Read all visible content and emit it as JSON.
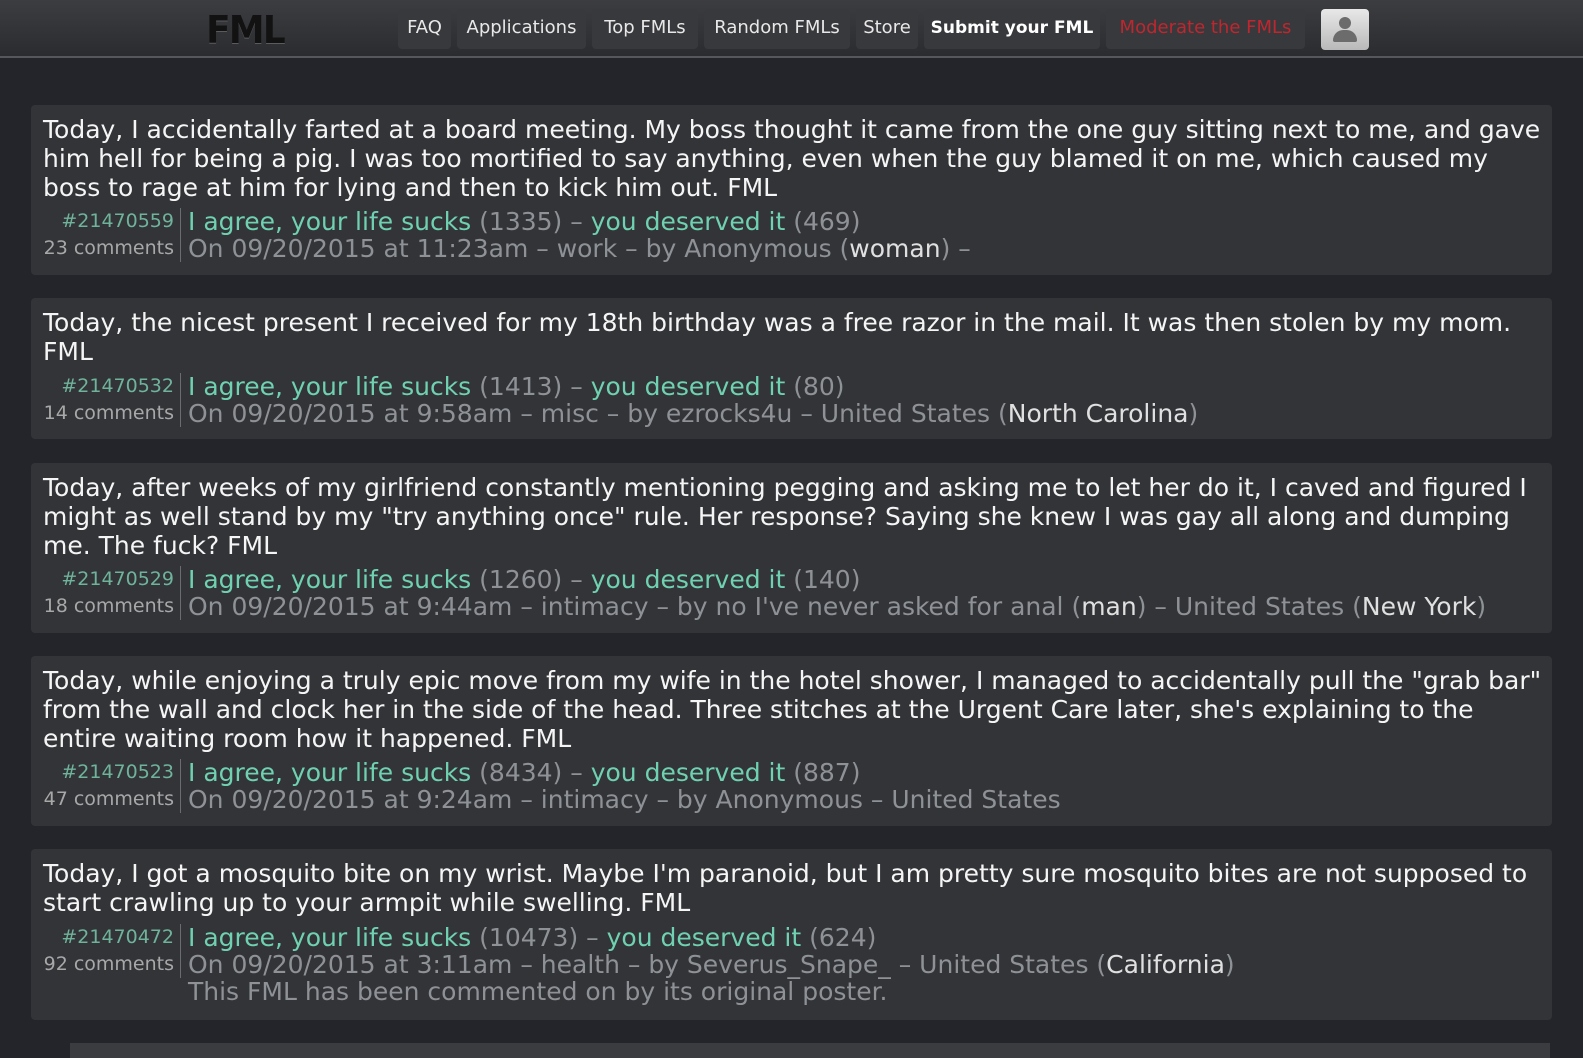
{
  "header": {
    "logo": "FML",
    "nav": [
      {
        "label": "FAQ"
      },
      {
        "label": "Applications"
      },
      {
        "label": "Top FMLs"
      },
      {
        "label": "Random FMLs"
      },
      {
        "label": "Store"
      },
      {
        "label": "Submit your FML"
      },
      {
        "label": "Moderate the FMLs"
      }
    ],
    "user_icon": "user-icon"
  },
  "posts": [
    {
      "text": "Today, I accidentally farted at a board meeting. My boss thought it came from the one guy sitting next to me, and gave him hell for being a pig. I was too mortified to say anything, even when the guy blamed it on me, which caused my boss to rage at him for lying and then to kick him out. FML",
      "id": "#21470559",
      "comments": "23 comments",
      "agree_label": "I agree, your life sucks",
      "agree_count": "(1335)",
      "sep": " – ",
      "deserved_label": "you deserved it",
      "deserved_count": "(469)",
      "date_line": "On 09/20/2015 at 11:23am – work – by Anonymous (",
      "highlight": "woman",
      "date_tail": ") –",
      "extra": ""
    },
    {
      "text": "Today, the nicest present I received for my 18th birthday was a free razor in the mail. It was then stolen by my mom. FML",
      "id": "#21470532",
      "comments": "14 comments",
      "agree_label": "I agree, your life sucks",
      "agree_count": "(1413)",
      "sep": " – ",
      "deserved_label": "you deserved it",
      "deserved_count": "(80)",
      "date_line": "On 09/20/2015 at 9:58am – misc – by ezrocks4u – United States (",
      "highlight": "North Carolina",
      "date_tail": ")",
      "extra": ""
    },
    {
      "text": "Today, after weeks of my girlfriend constantly mentioning pegging and asking me to let her do it, I caved and figured I might as well stand by my \"try anything once\" rule. Her response? Saying she knew I was gay all along and dumping me. The fuck? FML",
      "id": "#21470529",
      "comments": "18 comments",
      "agree_label": "I agree, your life sucks",
      "agree_count": "(1260)",
      "sep": " – ",
      "deserved_label": "you deserved it",
      "deserved_count": "(140)",
      "date_line": "On 09/20/2015 at 9:44am – intimacy – by no I've never asked for anal (",
      "highlight": "man",
      "date_tail": ") – United States (",
      "highlight2": "New York",
      "date_tail2": ")",
      "extra": ""
    },
    {
      "text": "Today, while enjoying a truly epic move from my wife in the hotel shower, I managed to accidentally pull the \"grab bar\" from the wall and clock her in the side of the head. Three stitches at the Urgent Care later, she's explaining to the entire waiting room how it happened. FML",
      "id": "#21470523",
      "comments": "47 comments",
      "agree_label": "I agree, your life sucks",
      "agree_count": "(8434)",
      "sep": " – ",
      "deserved_label": "you deserved it",
      "deserved_count": "(887)",
      "date_line": "On 09/20/2015 at 9:24am – intimacy – by Anonymous – United States",
      "highlight": "",
      "date_tail": "",
      "extra": ""
    },
    {
      "text": "Today, I got a mosquito bite on my wrist. Maybe I'm paranoid, but I am pretty sure mosquito bites are not supposed to start crawling up to your armpit while swelling. FML",
      "id": "#21470472",
      "comments": "92 comments",
      "agree_label": "I agree, your life sucks",
      "agree_count": "(10473)",
      "sep": " – ",
      "deserved_label": "you deserved it",
      "deserved_count": "(624)",
      "date_line": "On 09/20/2015 at 3:11am – health – by Severus_Snape_ – United States (",
      "highlight": "California",
      "date_tail": ")",
      "extra": "This FML has been commented on by its original poster."
    }
  ]
}
